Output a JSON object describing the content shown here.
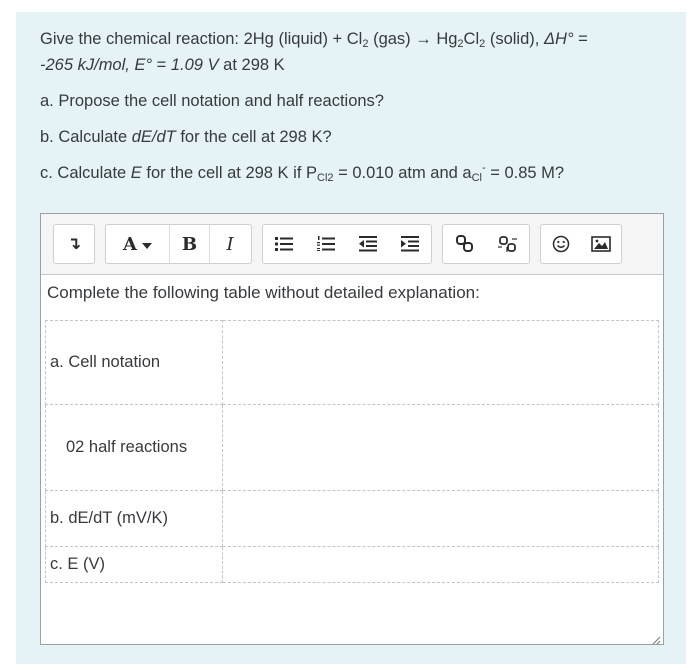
{
  "question": {
    "line1_prefix": "Give the chemical reaction: 2Hg (liquid) + Cl",
    "line1_sub1": "2",
    "line1_mid1": " (gas) → Hg",
    "line1_sub2": "2",
    "line1_mid2": "Cl",
    "line1_sub3": "2",
    "line1_mid3": " (solid), ",
    "line1_dh": "ΔH°",
    "line1_eq": " =",
    "line2_italic1": "-265 kJ/mol, E°",
    "line2_mid": " = ",
    "line2_italic2": "1.09 V",
    "line2_tail": " at 298 K",
    "part_a": "a. Propose the cell notation and half reactions?",
    "part_b_prefix": "b. Calculate ",
    "part_b_italic": "dE/dT",
    "part_b_suffix": " for the cell at 298 K?",
    "part_c_prefix": "c. Calculate ",
    "part_c_italic": "E",
    "part_c_mid": " for the cell at 298 K if P",
    "part_c_sub1": "Cl2",
    "part_c_mid2": " = 0.010 atm and a",
    "part_c_sub2": "Cl",
    "part_c_sup": "-",
    "part_c_tail": " = 0.85 M?"
  },
  "editor": {
    "toolbar": {
      "collapse_icon": "↴",
      "font_label": "A",
      "bold_label": "B",
      "italic_label": "I",
      "icons": [
        "collapse-icon",
        "font-color-icon",
        "bold-icon",
        "italic-icon",
        "bullet-list-icon",
        "numbered-list-icon",
        "outdent-icon",
        "indent-icon",
        "link-icon",
        "unlink-icon",
        "emoji-icon",
        "image-icon"
      ]
    },
    "instruction": "Complete the following table without detailed explanation:",
    "rows": [
      {
        "label": "a. Cell notation",
        "value": ""
      },
      {
        "label": "02 half reactions",
        "value": ""
      },
      {
        "label": "b. dE/dT (mV/K)",
        "value": ""
      },
      {
        "label": "c. E (V)",
        "value": ""
      }
    ]
  }
}
